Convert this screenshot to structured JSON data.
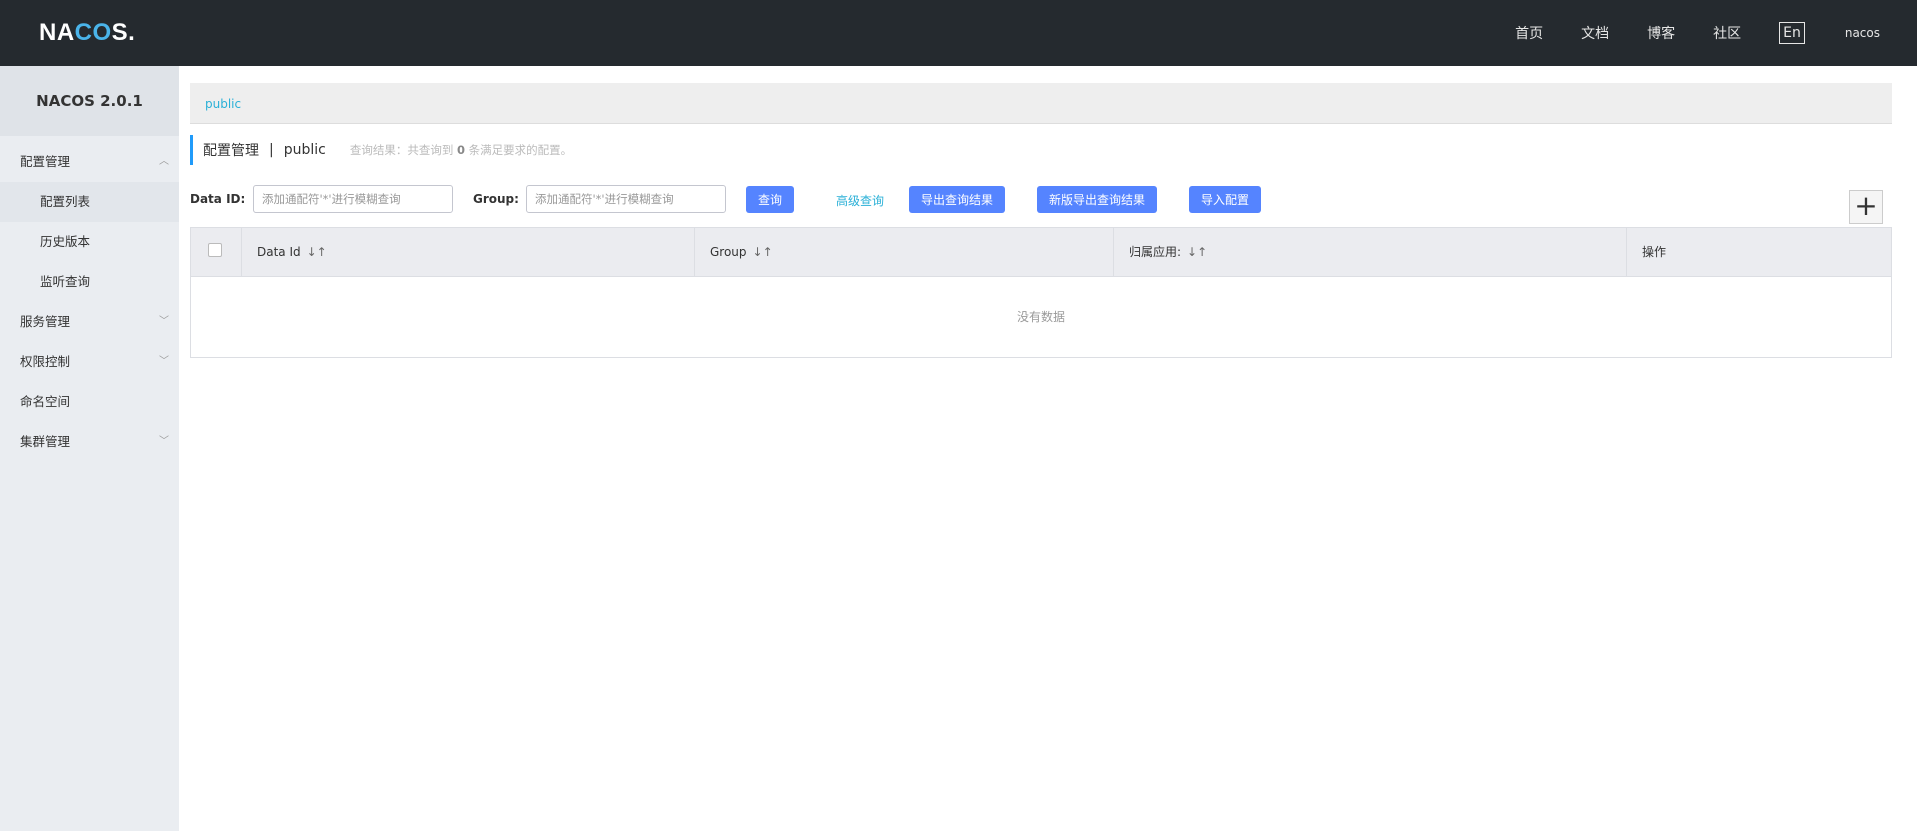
{
  "header": {
    "logo_main": "NA",
    "logo_accent": "CO",
    "logo_end": "S.",
    "nav": [
      "首页",
      "文档",
      "博客",
      "社区"
    ],
    "lang": "En",
    "user": "nacos"
  },
  "sidebar": {
    "title": "NACOS 2.0.1",
    "items": [
      {
        "label": "配置管理",
        "arrow": "^"
      },
      {
        "label": "配置列表"
      },
      {
        "label": "历史版本"
      },
      {
        "label": "监听查询"
      },
      {
        "label": "服务管理",
        "arrow": "v"
      },
      {
        "label": "权限控制",
        "arrow": "v"
      },
      {
        "label": "命名空间"
      },
      {
        "label": "集群管理",
        "arrow": "v"
      }
    ]
  },
  "breadcrumb": {
    "namespace": "public"
  },
  "page": {
    "title": "配置管理",
    "separator": "|",
    "namespace": "public",
    "result_prefix": "查询结果：共查询到",
    "result_count": "0",
    "result_suffix": "条满足要求的配置。"
  },
  "search": {
    "data_id_label": "Data ID:",
    "data_id_placeholder": "添加通配符'*'进行模糊查询",
    "group_label": "Group:",
    "group_placeholder": "添加通配符'*'进行模糊查询",
    "query_btn": "查询",
    "advanced_link": "高级查询",
    "export_btn": "导出查询结果",
    "export_new_btn": "新版导出查询结果",
    "import_btn": "导入配置",
    "add_btn": "+"
  },
  "table": {
    "columns": [
      "Data Id",
      "Group",
      "归属应用:",
      "操作"
    ],
    "sort_icon": "↓↑",
    "empty": "没有数据"
  }
}
